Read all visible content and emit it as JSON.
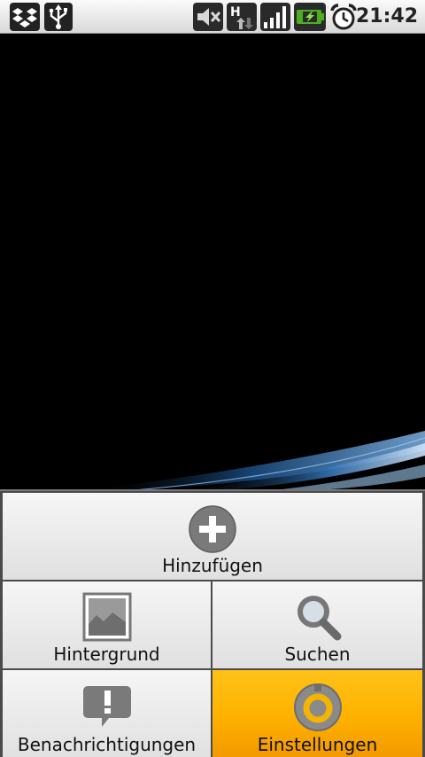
{
  "status_bar": {
    "time": "21:42",
    "icons": [
      "dropbox-icon",
      "usb-icon",
      "mute-icon",
      "hspa-data-icon",
      "signal-icon",
      "battery-charging-icon",
      "alarm-icon"
    ],
    "network_label": "H"
  },
  "menu": {
    "items": [
      {
        "label": "Hinzufügen",
        "icon": "add-icon"
      },
      {
        "label": "Hintergrund",
        "icon": "wallpaper-icon"
      },
      {
        "label": "Suchen",
        "icon": "search-icon"
      },
      {
        "label": "Benachrichtigungen",
        "icon": "notifications-icon"
      },
      {
        "label": "Einstellungen",
        "icon": "settings-icon",
        "selected": true
      }
    ]
  },
  "colors": {
    "menu_selected": "#ffb300",
    "wallpaper_accent": "#2f6fb0"
  }
}
